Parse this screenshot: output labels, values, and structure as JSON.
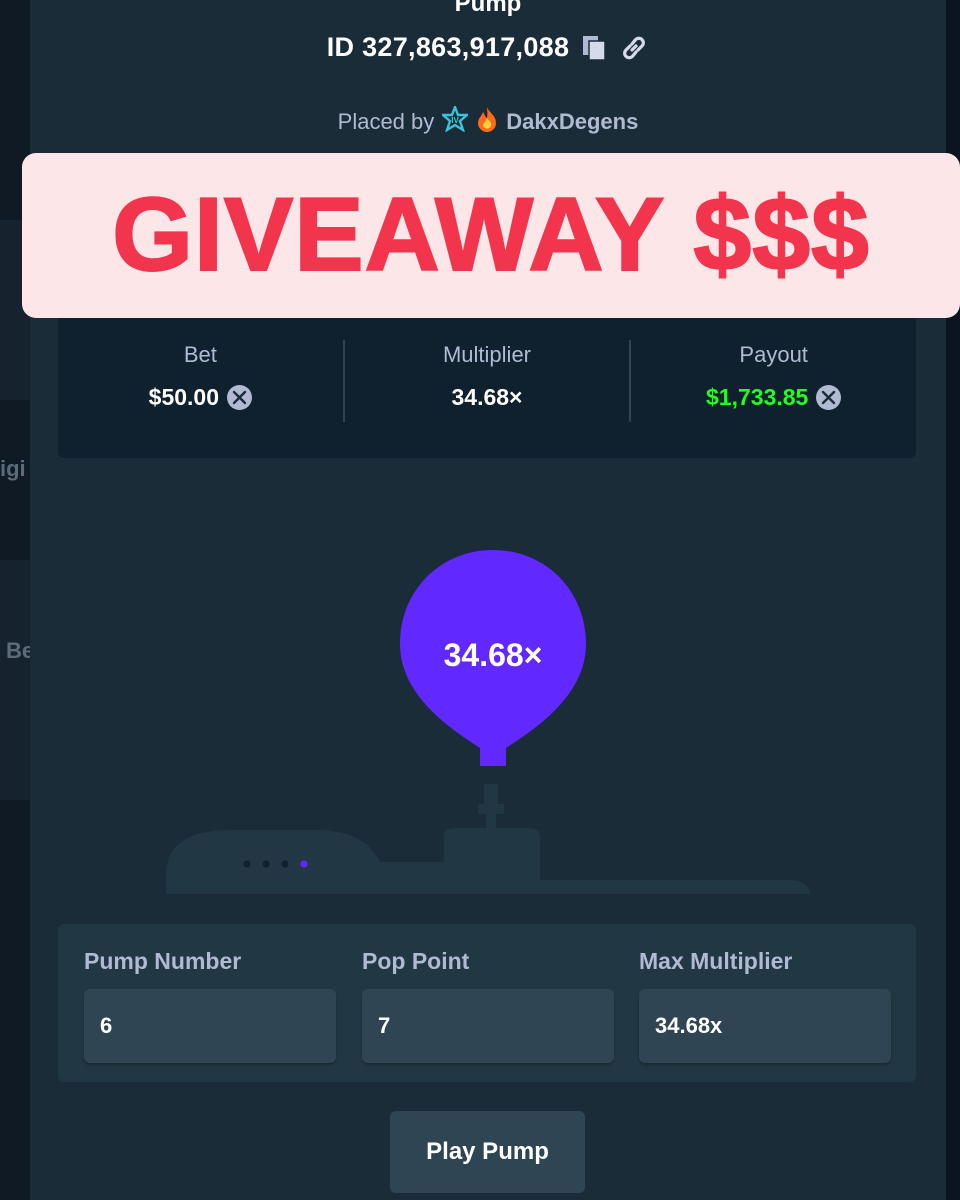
{
  "background": {
    "partial_text_1": "igi",
    "partial_text_2": "Be"
  },
  "header": {
    "game_name": "Pump",
    "bet_id": "ID 327,863,917,088",
    "placed_by_label": "Placed by",
    "username": "DakxDegens"
  },
  "banner": {
    "text": "GIVEAWAY $$$"
  },
  "stats": {
    "bet_label": "Bet",
    "bet_value": "$50.00",
    "multiplier_label": "Multiplier",
    "multiplier_value": "34.68×",
    "payout_label": "Payout",
    "payout_value": "$1,733.85"
  },
  "balloon": {
    "multiplier": "34.68×",
    "pump_dots_total": 4,
    "pump_dots_active": 1
  },
  "fields": {
    "pump_number_label": "Pump Number",
    "pump_number_value": "6",
    "pop_point_label": "Pop Point",
    "pop_point_value": "7",
    "max_multiplier_label": "Max Multiplier",
    "max_multiplier_value": "34.68x"
  },
  "actions": {
    "play_label": "Play Pump"
  },
  "colors": {
    "modal_bg": "#1a2c38",
    "card_bg": "#0f212e",
    "balloon": "#6129ff",
    "payout_green": "#1fff20",
    "banner_bg": "#fde6e7",
    "banner_text": "#f2354d"
  }
}
